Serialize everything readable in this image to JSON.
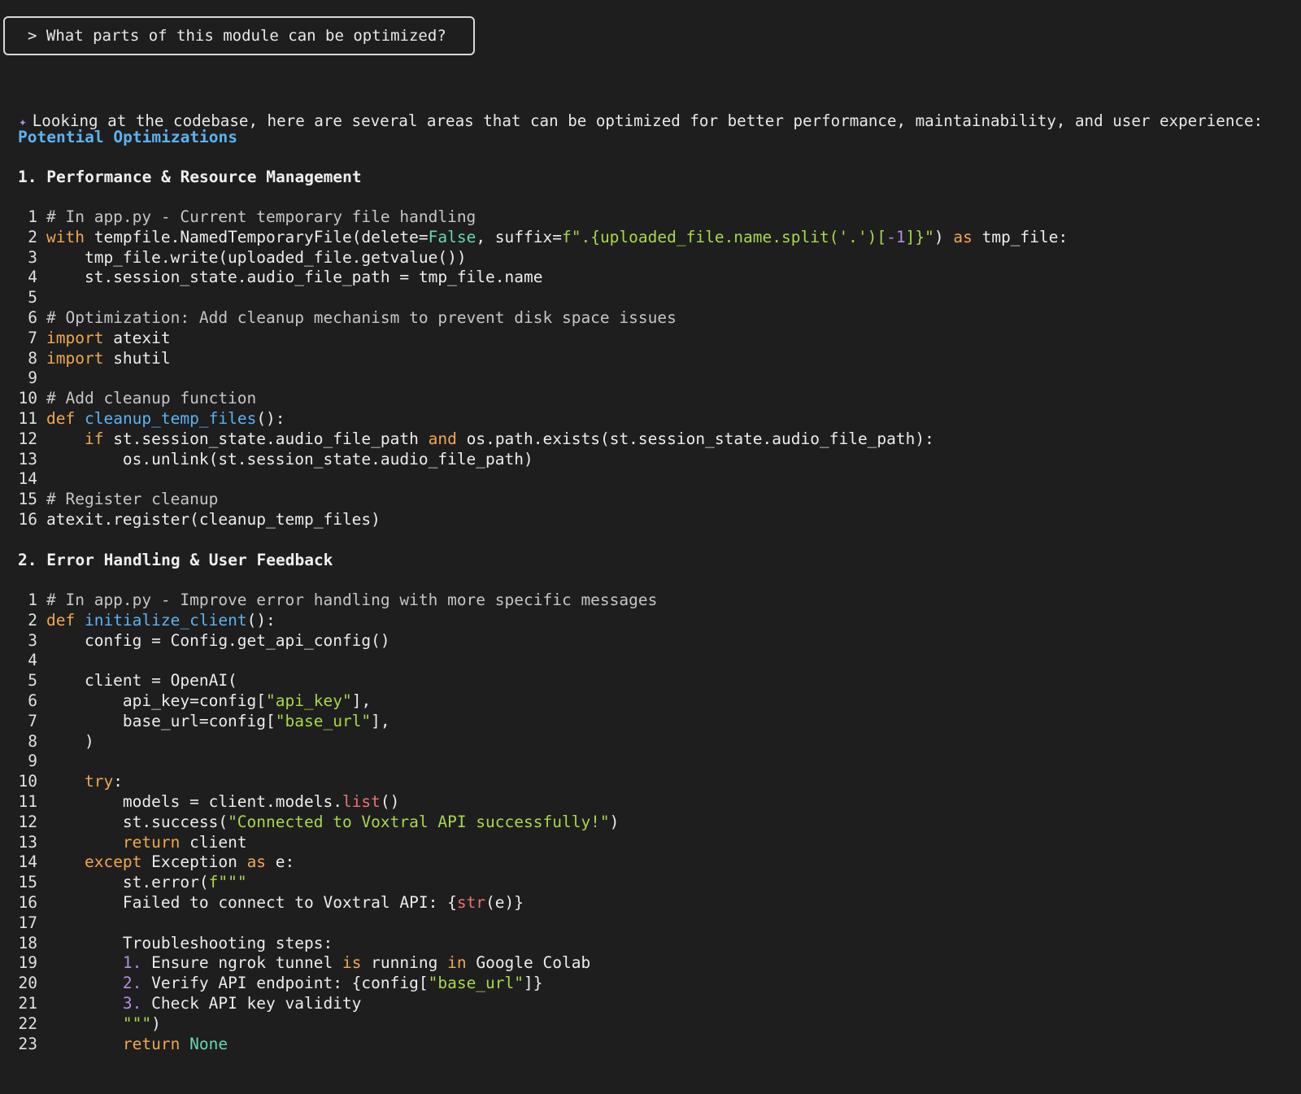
{
  "prompt": {
    "text": "> What parts of this module can be optimized?"
  },
  "response": {
    "bullet_icon": "sparkle-icon",
    "intro": "Looking at the codebase, here are several areas that can be optimized for better performance, maintainability, and user experience:",
    "heading": "Potential Optimizations",
    "sections": [
      {
        "title": "1. Performance & Resource Management",
        "code": [
          {
            "n": "1",
            "tokens": [
              {
                "t": "# In app.py - Current temporary file handling",
                "c": "comment"
              }
            ]
          },
          {
            "n": "2",
            "tokens": [
              {
                "t": "with",
                "c": "keyword"
              },
              {
                "t": " tempfile.NamedTemporaryFile(delete=",
                "c": "plain"
              },
              {
                "t": "False",
                "c": "const"
              },
              {
                "t": ", suffix=",
                "c": "plain"
              },
              {
                "t": "f\".{uploaded_file.name.split('.')[",
                "c": "string"
              },
              {
                "t": "-1",
                "c": "number"
              },
              {
                "t": "]}\"",
                "c": "string"
              },
              {
                "t": ") ",
                "c": "plain"
              },
              {
                "t": "as",
                "c": "keyword"
              },
              {
                "t": " tmp_file:",
                "c": "plain"
              }
            ]
          },
          {
            "n": "3",
            "tokens": [
              {
                "t": "    tmp_file.write(uploaded_file.getvalue())",
                "c": "plain"
              }
            ]
          },
          {
            "n": "4",
            "tokens": [
              {
                "t": "    st.session_state.audio_file_path = tmp_file.name",
                "c": "plain"
              }
            ]
          },
          {
            "n": "5",
            "tokens": []
          },
          {
            "n": "6",
            "tokens": [
              {
                "t": "# Optimization: Add cleanup mechanism to prevent disk space issues",
                "c": "comment"
              }
            ]
          },
          {
            "n": "7",
            "tokens": [
              {
                "t": "import",
                "c": "keyword"
              },
              {
                "t": " atexit",
                "c": "plain"
              }
            ]
          },
          {
            "n": "8",
            "tokens": [
              {
                "t": "import",
                "c": "keyword"
              },
              {
                "t": " shutil",
                "c": "plain"
              }
            ]
          },
          {
            "n": "9",
            "tokens": []
          },
          {
            "n": "10",
            "tokens": [
              {
                "t": "# Add cleanup function",
                "c": "comment"
              }
            ]
          },
          {
            "n": "11",
            "tokens": [
              {
                "t": "def",
                "c": "keyword"
              },
              {
                "t": " ",
                "c": "plain"
              },
              {
                "t": "cleanup_temp_files",
                "c": "func"
              },
              {
                "t": "():",
                "c": "plain"
              }
            ]
          },
          {
            "n": "12",
            "tokens": [
              {
                "t": "    ",
                "c": "plain"
              },
              {
                "t": "if",
                "c": "keyword"
              },
              {
                "t": " st.session_state.audio_file_path ",
                "c": "plain"
              },
              {
                "t": "and",
                "c": "keyword"
              },
              {
                "t": " os.path.exists(st.session_state.audio_file_path):",
                "c": "plain"
              }
            ]
          },
          {
            "n": "13",
            "tokens": [
              {
                "t": "        os.unlink(st.session_state.audio_file_path)",
                "c": "plain"
              }
            ]
          },
          {
            "n": "14",
            "tokens": []
          },
          {
            "n": "15",
            "tokens": [
              {
                "t": "# Register cleanup",
                "c": "comment"
              }
            ]
          },
          {
            "n": "16",
            "tokens": [
              {
                "t": "atexit.register(cleanup_temp_files)",
                "c": "plain"
              }
            ]
          }
        ]
      },
      {
        "title": "2. Error Handling & User Feedback",
        "code": [
          {
            "n": "1",
            "tokens": [
              {
                "t": "# In app.py - Improve error handling with more specific messages",
                "c": "comment"
              }
            ]
          },
          {
            "n": "2",
            "tokens": [
              {
                "t": "def",
                "c": "keyword"
              },
              {
                "t": " ",
                "c": "plain"
              },
              {
                "t": "initialize_client",
                "c": "func"
              },
              {
                "t": "():",
                "c": "plain"
              }
            ]
          },
          {
            "n": "3",
            "tokens": [
              {
                "t": "    config = Config.get_api_config()",
                "c": "plain"
              }
            ]
          },
          {
            "n": "4",
            "tokens": []
          },
          {
            "n": "5",
            "tokens": [
              {
                "t": "    client = OpenAI(",
                "c": "plain"
              }
            ]
          },
          {
            "n": "6",
            "tokens": [
              {
                "t": "        api_key=config[",
                "c": "plain"
              },
              {
                "t": "\"api_key\"",
                "c": "string"
              },
              {
                "t": "],",
                "c": "plain"
              }
            ]
          },
          {
            "n": "7",
            "tokens": [
              {
                "t": "        base_url=config[",
                "c": "plain"
              },
              {
                "t": "\"base_url\"",
                "c": "string"
              },
              {
                "t": "],",
                "c": "plain"
              }
            ]
          },
          {
            "n": "8",
            "tokens": [
              {
                "t": "    )",
                "c": "plain"
              }
            ]
          },
          {
            "n": "9",
            "tokens": []
          },
          {
            "n": "10",
            "tokens": [
              {
                "t": "    ",
                "c": "plain"
              },
              {
                "t": "try",
                "c": "keyword"
              },
              {
                "t": ":",
                "c": "plain"
              }
            ]
          },
          {
            "n": "11",
            "tokens": [
              {
                "t": "        models = client.models.",
                "c": "plain"
              },
              {
                "t": "list",
                "c": "builtin"
              },
              {
                "t": "()",
                "c": "plain"
              }
            ]
          },
          {
            "n": "12",
            "tokens": [
              {
                "t": "        st.success(",
                "c": "plain"
              },
              {
                "t": "\"Connected to Voxtral API successfully!\"",
                "c": "string"
              },
              {
                "t": ")",
                "c": "plain"
              }
            ]
          },
          {
            "n": "13",
            "tokens": [
              {
                "t": "        ",
                "c": "plain"
              },
              {
                "t": "return",
                "c": "keyword"
              },
              {
                "t": " client",
                "c": "plain"
              }
            ]
          },
          {
            "n": "14",
            "tokens": [
              {
                "t": "    ",
                "c": "plain"
              },
              {
                "t": "except",
                "c": "keyword"
              },
              {
                "t": " Exception ",
                "c": "plain"
              },
              {
                "t": "as",
                "c": "keyword"
              },
              {
                "t": " e:",
                "c": "plain"
              }
            ]
          },
          {
            "n": "15",
            "tokens": [
              {
                "t": "        st.error(",
                "c": "plain"
              },
              {
                "t": "f\"\"\"",
                "c": "string"
              }
            ]
          },
          {
            "n": "16",
            "tokens": [
              {
                "t": "        Failed to connect to Voxtral API: {",
                "c": "plain"
              },
              {
                "t": "str",
                "c": "builtin"
              },
              {
                "t": "(e)}",
                "c": "plain"
              }
            ]
          },
          {
            "n": "17",
            "tokens": []
          },
          {
            "n": "18",
            "tokens": [
              {
                "t": "        Troubleshooting steps:",
                "c": "plain"
              }
            ]
          },
          {
            "n": "19",
            "tokens": [
              {
                "t": "        ",
                "c": "plain"
              },
              {
                "t": "1.",
                "c": "number"
              },
              {
                "t": " Ensure ngrok tunnel ",
                "c": "plain"
              },
              {
                "t": "is",
                "c": "keyword"
              },
              {
                "t": " running ",
                "c": "plain"
              },
              {
                "t": "in",
                "c": "keyword"
              },
              {
                "t": " Google Colab",
                "c": "plain"
              }
            ]
          },
          {
            "n": "20",
            "tokens": [
              {
                "t": "        ",
                "c": "plain"
              },
              {
                "t": "2.",
                "c": "number"
              },
              {
                "t": " Verify API endpoint: {config[",
                "c": "plain"
              },
              {
                "t": "\"base_url\"",
                "c": "string"
              },
              {
                "t": "]}",
                "c": "plain"
              }
            ]
          },
          {
            "n": "21",
            "tokens": [
              {
                "t": "        ",
                "c": "plain"
              },
              {
                "t": "3.",
                "c": "number"
              },
              {
                "t": " Check API key validity",
                "c": "plain"
              }
            ]
          },
          {
            "n": "22",
            "tokens": [
              {
                "t": "        ",
                "c": "plain"
              },
              {
                "t": "\"\"\"",
                "c": "string"
              },
              {
                "t": ")",
                "c": "plain"
              }
            ]
          },
          {
            "n": "23",
            "tokens": [
              {
                "t": "        ",
                "c": "plain"
              },
              {
                "t": "return",
                "c": "keyword"
              },
              {
                "t": " ",
                "c": "plain"
              },
              {
                "t": "None",
                "c": "const"
              }
            ]
          }
        ]
      }
    ]
  }
}
